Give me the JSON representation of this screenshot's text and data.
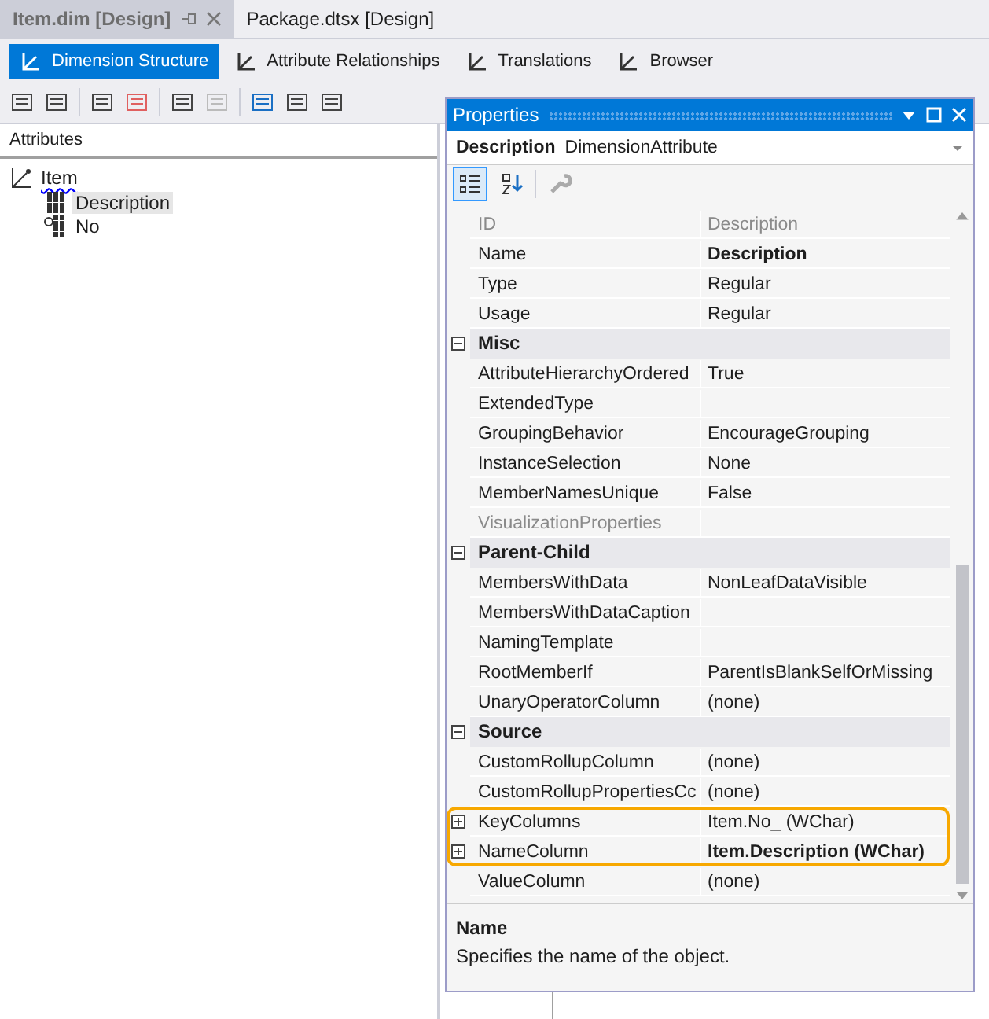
{
  "doc_tabs": [
    {
      "label": "Item.dim [Design]",
      "selected": true,
      "pinnable": true
    },
    {
      "label": "Package.dtsx [Design]",
      "selected": false,
      "pinnable": false
    }
  ],
  "designer_tabs": [
    {
      "label": "Dimension Structure",
      "selected": true
    },
    {
      "label": "Attribute Relationships",
      "selected": false
    },
    {
      "label": "Translations",
      "selected": false
    },
    {
      "label": "Browser",
      "selected": false
    }
  ],
  "attributes_pane": {
    "title": "Attributes",
    "tree": {
      "label": "Item",
      "children": [
        {
          "label": "Description",
          "kind": "attribute",
          "selected": true
        },
        {
          "label": "No",
          "kind": "key",
          "selected": false
        }
      ]
    }
  },
  "properties": {
    "title": "Properties",
    "object_name": "Description",
    "object_type": "DimensionAttribute",
    "grid": [
      {
        "kind": "property",
        "name": "ID",
        "value": "Description",
        "disabled": true,
        "bold": false,
        "expandable": false,
        "highlighted": false
      },
      {
        "kind": "property",
        "name": "Name",
        "value": "Description",
        "disabled": false,
        "bold": true,
        "expandable": false,
        "highlighted": false
      },
      {
        "kind": "property",
        "name": "Type",
        "value": "Regular",
        "disabled": false,
        "bold": false,
        "expandable": false,
        "highlighted": false
      },
      {
        "kind": "property",
        "name": "Usage",
        "value": "Regular",
        "disabled": false,
        "bold": false,
        "expandable": false,
        "highlighted": false
      },
      {
        "kind": "category",
        "label": "Misc",
        "expanded": true
      },
      {
        "kind": "property",
        "name": "AttributeHierarchyOrdered",
        "value": "True",
        "disabled": false,
        "bold": false,
        "expandable": false,
        "highlighted": false
      },
      {
        "kind": "property",
        "name": "ExtendedType",
        "disabled": false,
        "expandable": false,
        "highlighted": false
      },
      {
        "kind": "property",
        "name": "GroupingBehavior",
        "value": "EncourageGrouping",
        "disabled": false,
        "bold": false,
        "expandable": false,
        "highlighted": false
      },
      {
        "kind": "property",
        "name": "InstanceSelection",
        "value": "None",
        "disabled": false,
        "bold": false,
        "expandable": false,
        "highlighted": false
      },
      {
        "kind": "property",
        "name": "MemberNamesUnique",
        "value": "False",
        "disabled": false,
        "bold": false,
        "expandable": false,
        "highlighted": false
      },
      {
        "kind": "property",
        "name": "VisualizationProperties",
        "disabled": true,
        "expandable": false,
        "highlighted": false
      },
      {
        "kind": "category",
        "label": "Parent-Child",
        "expanded": true
      },
      {
        "kind": "property",
        "name": "MembersWithData",
        "value": "NonLeafDataVisible",
        "disabled": false,
        "bold": false,
        "expandable": false,
        "highlighted": false
      },
      {
        "kind": "property",
        "name": "MembersWithDataCaption",
        "disabled": false,
        "expandable": false,
        "highlighted": false
      },
      {
        "kind": "property",
        "name": "NamingTemplate",
        "disabled": false,
        "expandable": false,
        "highlighted": false
      },
      {
        "kind": "property",
        "name": "RootMemberIf",
        "value": "ParentIsBlankSelfOrMissing",
        "disabled": false,
        "bold": false,
        "expandable": false,
        "highlighted": false
      },
      {
        "kind": "property",
        "name": "UnaryOperatorColumn",
        "value": "(none)",
        "disabled": false,
        "bold": false,
        "expandable": false,
        "highlighted": false
      },
      {
        "kind": "category",
        "label": "Source",
        "expanded": true
      },
      {
        "kind": "property",
        "name": "CustomRollupColumn",
        "value": "(none)",
        "disabled": false,
        "bold": false,
        "expandable": false,
        "highlighted": false
      },
      {
        "kind": "property",
        "name": "CustomRollupPropertiesCc",
        "value": "(none)",
        "disabled": false,
        "bold": false,
        "expandable": false,
        "highlighted": false
      },
      {
        "kind": "property",
        "name": "KeyColumns",
        "value": "Item.No_ (WChar)",
        "disabled": false,
        "bold": false,
        "expandable": true,
        "highlighted": true
      },
      {
        "kind": "property",
        "name": "NameColumn",
        "value": "Item.Description (WChar)",
        "disabled": false,
        "bold": true,
        "expandable": true,
        "highlighted": true
      },
      {
        "kind": "property",
        "name": "ValueColumn",
        "value": "(none)",
        "disabled": false,
        "bold": false,
        "expandable": false,
        "highlighted": false
      }
    ],
    "help": {
      "title": "Name",
      "text": "Specifies the name of the object."
    }
  }
}
